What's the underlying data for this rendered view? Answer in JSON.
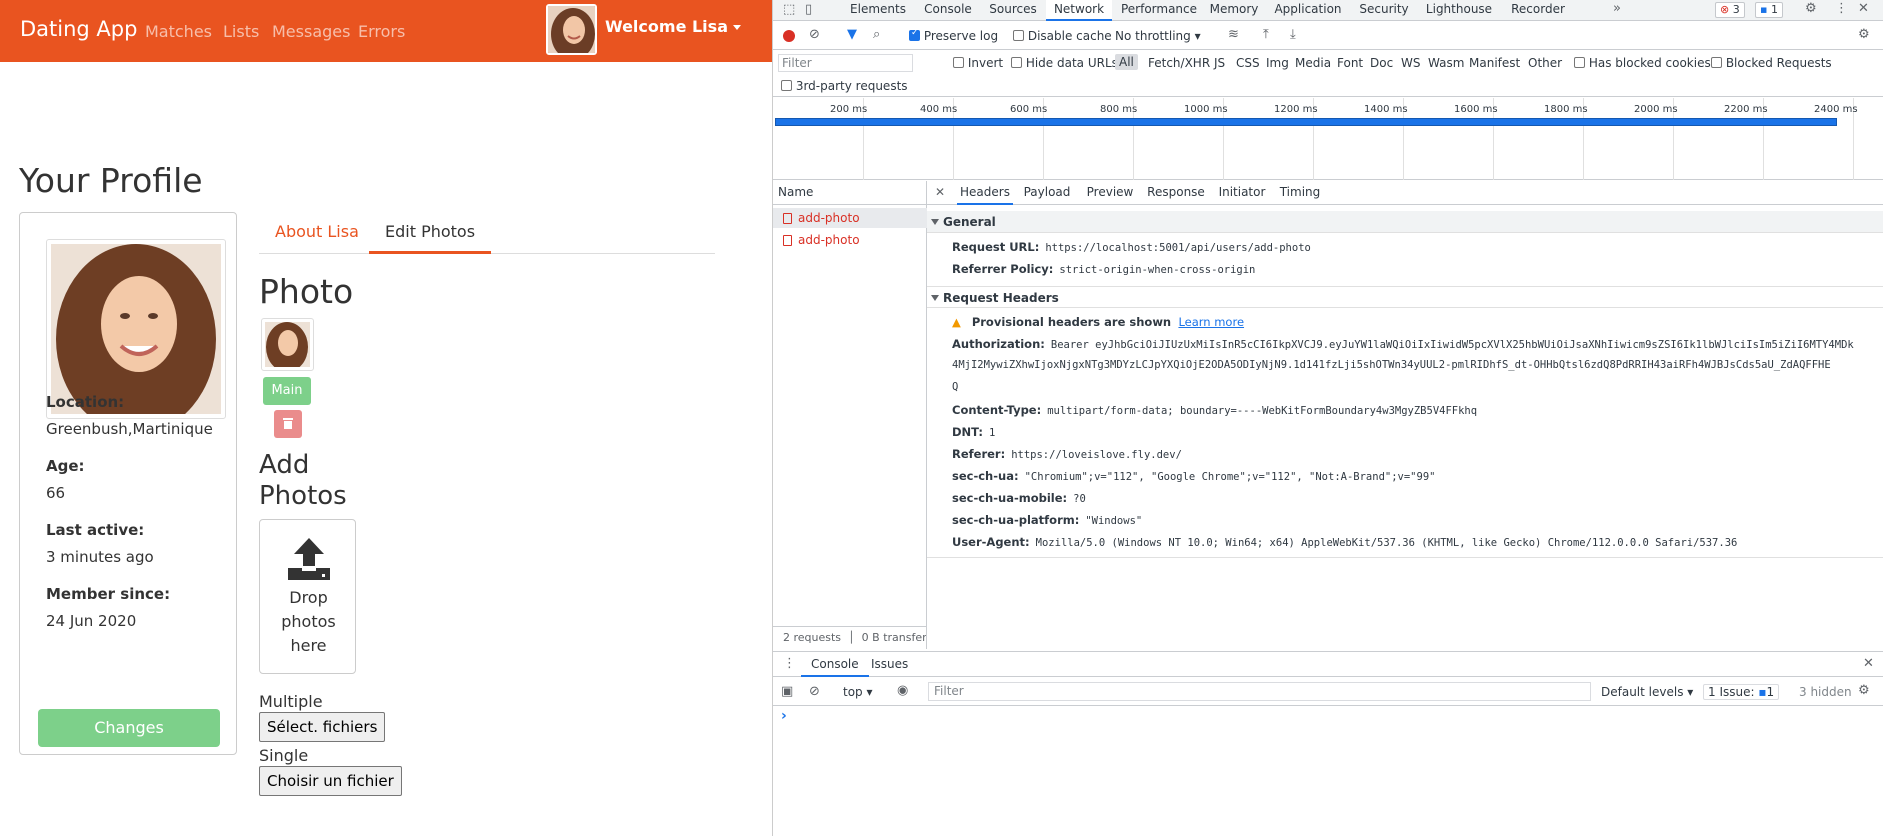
{
  "app": {
    "brand": "Dating App",
    "nav": [
      "Matches",
      "Lists",
      "Messages",
      "Errors"
    ],
    "welcome": "Welcome Lisa",
    "page_title": "Your Profile",
    "profile": {
      "location_label": "Location:",
      "location": "Greenbush,Martinique",
      "age_label": "Age:",
      "age": "66",
      "last_active_label": "Last active:",
      "last_active": "3 minutes ago",
      "member_since_label": "Member since:",
      "member_since": "24 Jun 2020",
      "changes_button": "Changes"
    },
    "tabs": [
      "About Lisa",
      "Edit Photos"
    ],
    "photo_heading": "Photo",
    "main_button": "Main",
    "add_photos_heading_1": "Add",
    "add_photos_heading_2": "Photos",
    "dropzone_text_1": "Drop",
    "dropzone_text_2": "photos",
    "dropzone_text_3": "here",
    "multiple_label": "Multiple",
    "multiple_button": "Sélect. fichiers",
    "single_label": "Single",
    "single_button": "Choisir un fichier"
  },
  "devtools": {
    "tabs": [
      "Elements",
      "Console",
      "Sources",
      "Network",
      "Performance",
      "Memory",
      "Application",
      "Security",
      "Lighthouse",
      "Recorder"
    ],
    "active_tab": "Network",
    "error_count": "3",
    "message_count": "1",
    "toolbar": {
      "preserve_log": "Preserve log",
      "disable_cache": "Disable cache",
      "throttling": "No throttling"
    },
    "filter": {
      "placeholder": "Filter",
      "invert": "Invert",
      "hide_data_urls": "Hide data URLs",
      "types": [
        "All",
        "Fetch/XHR",
        "JS",
        "CSS",
        "Img",
        "Media",
        "Font",
        "Doc",
        "WS",
        "Wasm",
        "Manifest",
        "Other"
      ],
      "blocked_cookies": "Has blocked cookies",
      "blocked_requests": "Blocked Requests",
      "third_party": "3rd-party requests"
    },
    "timeline_ticks": [
      "200 ms",
      "400 ms",
      "600 ms",
      "800 ms",
      "1000 ms",
      "1200 ms",
      "1400 ms",
      "1600 ms",
      "1800 ms",
      "2000 ms",
      "2200 ms",
      "2400 ms"
    ],
    "requests": {
      "header": "Name",
      "rows": [
        "add-photo",
        "add-photo"
      ],
      "summary": "2 requests",
      "transfer": "0 B transferr"
    },
    "detail_tabs": [
      "Headers",
      "Payload",
      "Preview",
      "Response",
      "Initiator",
      "Timing"
    ],
    "general": {
      "title": "General",
      "request_url_label": "Request URL:",
      "request_url": "https://localhost:5001/api/users/add-photo",
      "referrer_policy_label": "Referrer Policy:",
      "referrer_policy": "strict-origin-when-cross-origin"
    },
    "request_headers": {
      "title": "Request Headers",
      "provisional": "Provisional headers are shown",
      "learn_more": "Learn more",
      "authorization_label": "Authorization:",
      "authorization_1": "Bearer eyJhbGciOiJIUzUxMiIsInR5cCI6IkpXVCJ9.eyJuYW1laWQiOiIxIiwidW5pcXVlX25hbWUiOiJsaXNhIiwicm9sZSI6Ik1lbWJlciIsIm5iZiI6MTY4MDk",
      "authorization_2": "4MjI2MywiZXhwIjoxNjgxNTg3MDYzLCJpYXQiOjE2ODA5ODIyNjN9.1d141fzLji5shOTWn34yUUL2-pmlRIDhfS_dt-OHHbQtsl6zdQ8PdRRIH43aiRFh4WJBJsCds5aU_ZdAQFFHE",
      "authorization_3": "Q",
      "content_type_label": "Content-Type:",
      "content_type": "multipart/form-data; boundary=----WebKitFormBoundary4w3MgyZB5V4FFkhq",
      "dnt_label": "DNT:",
      "dnt": "1",
      "referer_label": "Referer:",
      "referer": "https://loveislove.fly.dev/",
      "sec_ch_ua_label": "sec-ch-ua:",
      "sec_ch_ua": "\"Chromium\";v=\"112\", \"Google Chrome\";v=\"112\", \"Not:A-Brand\";v=\"99\"",
      "sec_ch_ua_mobile_label": "sec-ch-ua-mobile:",
      "sec_ch_ua_mobile": "?0",
      "sec_ch_ua_platform_label": "sec-ch-ua-platform:",
      "sec_ch_ua_platform": "\"Windows\"",
      "user_agent_label": "User-Agent:",
      "user_agent": "Mozilla/5.0 (Windows NT 10.0; Win64; x64) AppleWebKit/537.36 (KHTML, like Gecko) Chrome/112.0.0.0 Safari/537.36"
    },
    "console": {
      "tabs": [
        "Console",
        "Issues"
      ],
      "context": "top",
      "filter_placeholder": "Filter",
      "levels": "Default levels",
      "issues": "1 Issue:",
      "issues_count": "1",
      "hidden": "3 hidden"
    }
  }
}
